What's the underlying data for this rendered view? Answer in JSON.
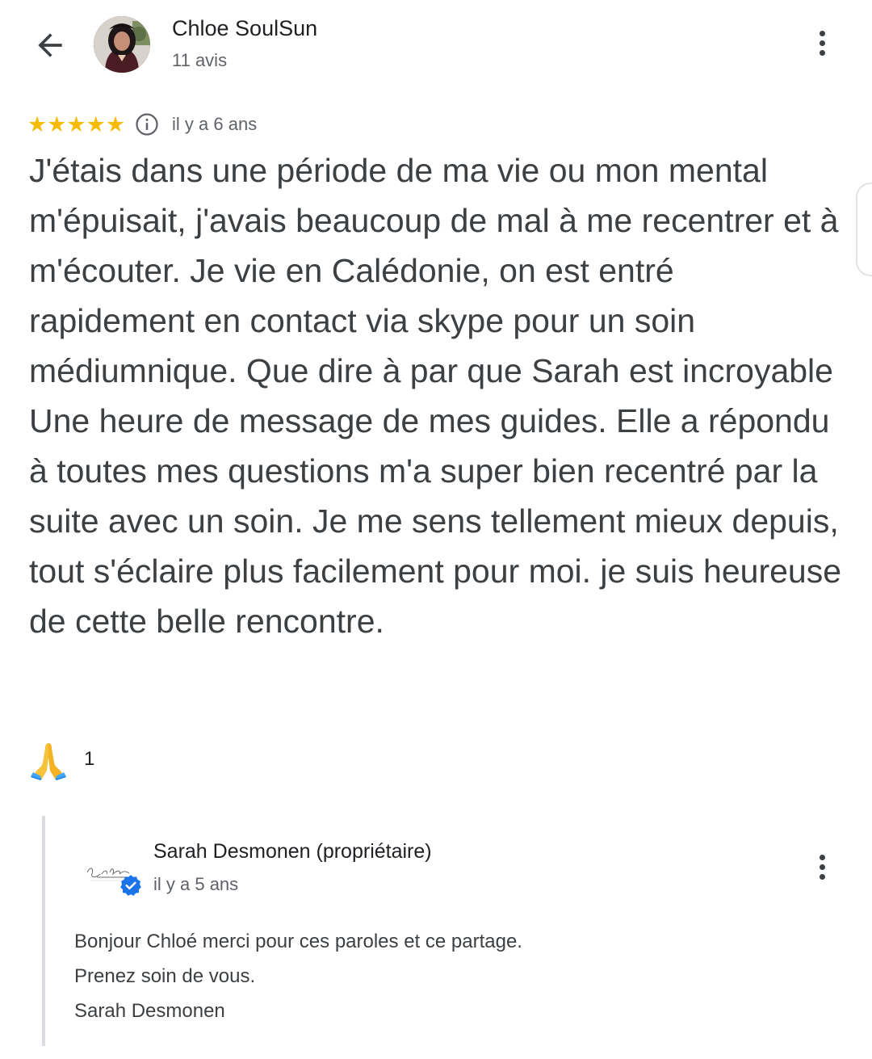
{
  "header": {
    "reviewer_name": "Chloe SoulSun",
    "reviewer_count": "11 avis",
    "back_icon": "arrow-back-icon",
    "menu_icon": "more-vert-icon"
  },
  "review": {
    "rating": 5,
    "rating_max": 5,
    "stars_text": "★★★★★",
    "age": "il y a 6 ans",
    "text": "J'étais dans une période de ma vie ou mon mental m'épuisait, j'avais beaucoup de mal à me recentrer et à m'écouter. Je vie en Calédonie, on est entré rapidement en contact via skype pour un soin médiumnique. Que dire à par que Sarah est incroyable Une heure de message de mes guides. Elle a répondu à toutes mes questions m'a super bien recentré par la suite avec un soin. Je me sens tellement mieux depuis, tout s'éclaire plus facilement pour moi. je suis heureuse de cette belle rencontre.",
    "reaction": {
      "icon": "folded-hands-emoji",
      "count": "1"
    }
  },
  "owner_reply": {
    "name": "Sarah Desmonen (propriétaire)",
    "age": "il y a 5 ans",
    "lines": [
      "Bonjour Chloé merci pour ces paroles et ce partage.",
      "Prenez soin de vous.",
      "Sarah Desmonen"
    ],
    "badge_icon": "verified-badge-icon"
  },
  "colors": {
    "star": "#f6bb06",
    "verified": "#1a73e8",
    "primary_text": "#202124",
    "secondary_text": "#5f6368"
  }
}
